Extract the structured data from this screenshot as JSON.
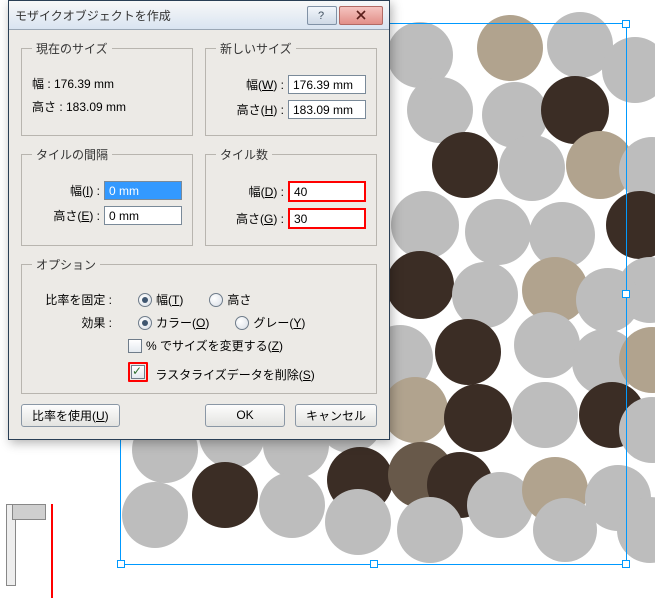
{
  "dialog": {
    "title": "モザイクオブジェクトを作成",
    "current_size": {
      "legend": "現在のサイズ",
      "width_label": "幅 : 176.39 mm",
      "height_label": "高さ : 183.09 mm"
    },
    "new_size": {
      "legend": "新しいサイズ",
      "width_label": "幅(W) :",
      "width_value": "176.39 mm",
      "height_label": "高さ(H) :",
      "height_value": "183.09 mm"
    },
    "tile_spacing": {
      "legend": "タイルの間隔",
      "width_label": "幅(I) :",
      "width_value": "0 mm",
      "height_label": "高さ(E) :",
      "height_value": "0 mm"
    },
    "tile_count": {
      "legend": "タイル数",
      "width_label": "幅(D) :",
      "width_value": "40",
      "height_label": "高さ(G) :",
      "height_value": "30"
    },
    "options": {
      "legend": "オプション",
      "constrain_ratio_label": "比率を固定 :",
      "ratio_width": "幅(T)",
      "ratio_height": "高さ",
      "effect_label": "効果 :",
      "effect_color": "カラー(O)",
      "effect_gray": "グレー(Y)",
      "resize_percent": "% でサイズを変更する(Z)",
      "delete_raster": "ラスタライズデータを削除(S)"
    },
    "buttons": {
      "use_ratio": "比率を使用(U)",
      "ok": "OK",
      "cancel": "キャンセル"
    }
  }
}
